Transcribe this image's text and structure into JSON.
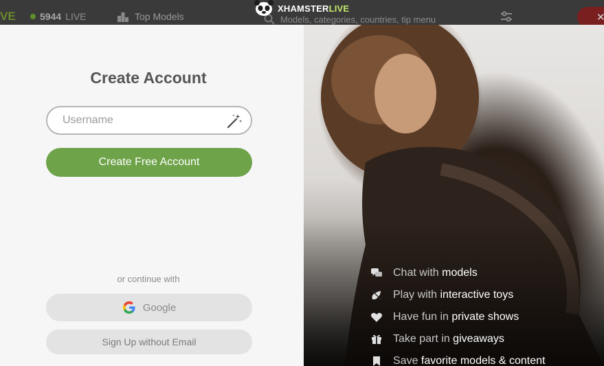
{
  "topbar": {
    "brand_fragment": "VE",
    "live_count": "5944",
    "live_label": "LIVE",
    "top_models_label": "Top Models",
    "search_placeholder": "Models, categories, countries, tip menu",
    "close_glyph": "✕"
  },
  "logo": {
    "word_main": "XHAMSTER",
    "word_live": "LIVE"
  },
  "signup": {
    "title": "Create Account",
    "username_placeholder": "Username",
    "username_value": "",
    "create_button": "Create Free Account",
    "or_continue": "or continue with",
    "google_button": "Google",
    "no_email_button": "Sign Up without Email"
  },
  "features": [
    {
      "icon": "chat-icon",
      "pre": "Chat with",
      "highlight": "models"
    },
    {
      "icon": "toy-icon",
      "pre": "Play with",
      "highlight": "interactive toys"
    },
    {
      "icon": "heart-icon",
      "pre": "Have fun in",
      "highlight": "private shows"
    },
    {
      "icon": "gift-icon",
      "pre": "Take part in",
      "highlight": "giveaways"
    },
    {
      "icon": "bookmark-icon",
      "pre": "Save",
      "highlight": "favorite models & content"
    }
  ],
  "colors": {
    "accent_green": "#6ea34a",
    "logo_live": "#c5e86c"
  }
}
